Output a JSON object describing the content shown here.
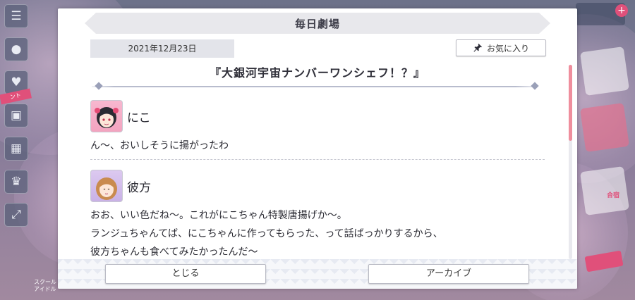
{
  "background": {
    "left_badge": "ント",
    "left_bottom_text": "スクールアイドル",
    "right_label": "合宿"
  },
  "modal": {
    "title": "毎日劇場",
    "date": "2021年12月23日",
    "favorite_label": "お気に入り",
    "story_title": "『大銀河宇宙ナンバーワンシェフ！？』",
    "dialogue": [
      {
        "speaker": "にこ",
        "avatar": "nico-avatar",
        "lines": [
          "ん〜、おいしそうに揚がったわ"
        ]
      },
      {
        "speaker": "彼方",
        "avatar": "kanata-avatar",
        "lines": [
          "おお、いい色だね〜。これがにこちゃん特製唐揚げか〜。",
          "ランジュちゃんてば、にこちゃんに作ってもらった、って話ばっかりするから、",
          "彼方ちゃんも食べてみたかったんだ〜"
        ]
      }
    ],
    "close_label": "とじる",
    "archive_label": "アーカイブ"
  },
  "colors": {
    "accent_pink": "#ef8e9d",
    "header_gray": "#e8e8ec"
  },
  "scroll_position": 0
}
